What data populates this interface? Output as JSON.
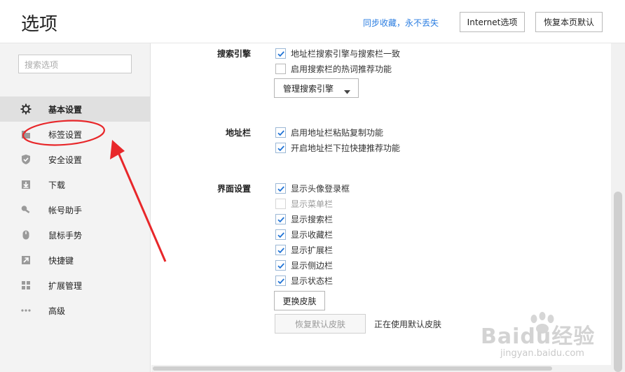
{
  "header": {
    "title": "选项",
    "sync_text": "同步收藏，永不丢失",
    "internet_options_label": "Internet选项",
    "restore_defaults_label": "恢复本页默认"
  },
  "sidebar": {
    "search_placeholder": "搜索选项",
    "items": [
      {
        "label": "基本设置",
        "icon": "gear-icon",
        "active": true
      },
      {
        "label": "标签设置",
        "icon": "tab-icon"
      },
      {
        "label": "安全设置",
        "icon": "shield-icon"
      },
      {
        "label": "下载",
        "icon": "download-icon"
      },
      {
        "label": "帐号助手",
        "icon": "key-icon"
      },
      {
        "label": "鼠标手势",
        "icon": "mouse-icon"
      },
      {
        "label": "快捷键",
        "icon": "shortcut-arrow-icon"
      },
      {
        "label": "扩展管理",
        "icon": "extensions-grid-icon"
      },
      {
        "label": "高级",
        "icon": "more-dots-icon"
      }
    ]
  },
  "sections": {
    "search_engine": {
      "title": "搜索引擎",
      "options": [
        {
          "label": "地址栏搜索引擎与搜索栏一致",
          "checked": true
        },
        {
          "label": "启用搜索栏的热词推荐功能",
          "checked": false
        }
      ],
      "manage_button_label": "管理搜索引擎"
    },
    "address_bar": {
      "title": "地址栏",
      "options": [
        {
          "label": "启用地址栏粘贴复制功能",
          "checked": true
        },
        {
          "label": "开启地址栏下拉快捷推荐功能",
          "checked": true
        }
      ]
    },
    "ui": {
      "title": "界面设置",
      "options": [
        {
          "label": "显示头像登录框",
          "checked": true
        },
        {
          "label": "显示菜单栏",
          "checked": false,
          "disabled": true
        },
        {
          "label": "显示搜索栏",
          "checked": true
        },
        {
          "label": "显示收藏栏",
          "checked": true
        },
        {
          "label": "显示扩展栏",
          "checked": true
        },
        {
          "label": "显示侧边栏",
          "checked": true
        },
        {
          "label": "显示状态栏",
          "checked": true
        }
      ],
      "change_skin_label": "更换皮肤",
      "restore_skin_label": "恢复默认皮肤",
      "skin_status": "正在使用默认皮肤"
    }
  },
  "watermark": {
    "brand": "Baidu经验",
    "url": "jingyan.baidu.com"
  },
  "colors": {
    "accent": "#2a7de1",
    "annotation": "#e8272a",
    "check": "#1f73d6"
  }
}
